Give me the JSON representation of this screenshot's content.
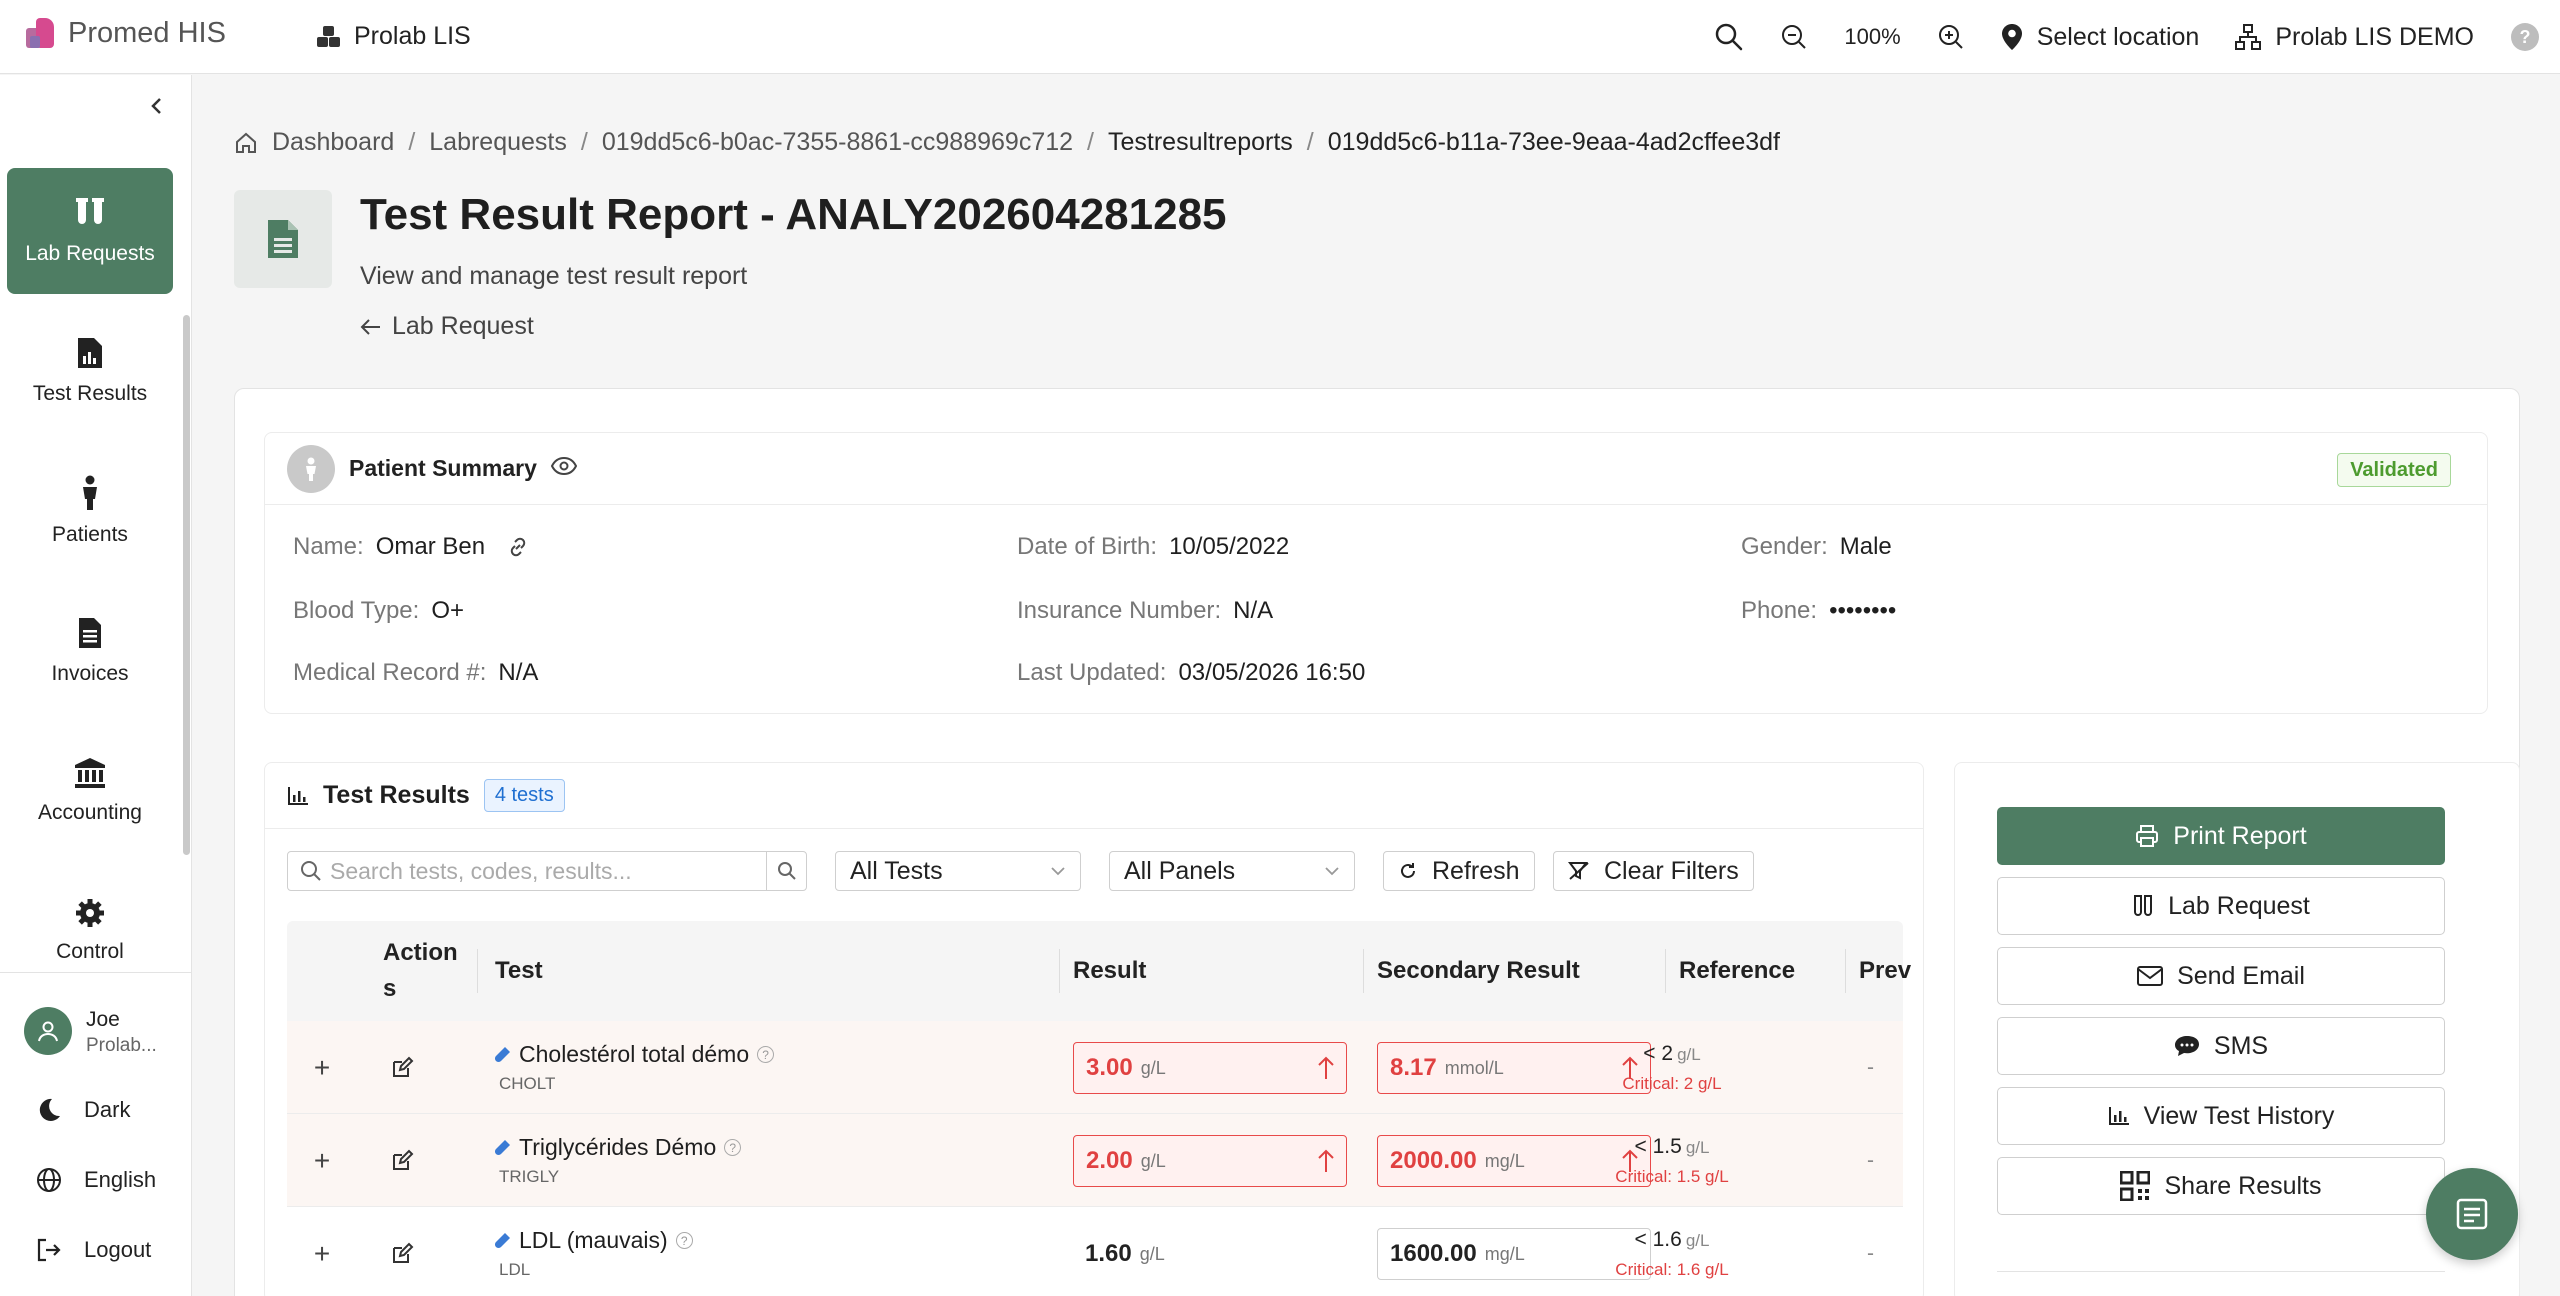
{
  "brand": {
    "name": "Promed HIS"
  },
  "app_switch": {
    "label": "Prolab LIS"
  },
  "topbar": {
    "zoom": "100%",
    "location": "Select location",
    "org": "Prolab LIS DEMO"
  },
  "sidebar": {
    "items": [
      {
        "label": "Lab Requests",
        "icon": "test-tubes-icon",
        "active": true
      },
      {
        "label": "Test Results",
        "icon": "report-chart-icon"
      },
      {
        "label": "Patients",
        "icon": "person-icon"
      },
      {
        "label": "Invoices",
        "icon": "invoice-icon"
      },
      {
        "label": "Accounting",
        "icon": "bank-icon"
      },
      {
        "label": "Control",
        "icon": "gear-icon"
      }
    ],
    "user": {
      "name": "Joe",
      "org": "Prolab..."
    },
    "dark_label": "Dark",
    "lang_label": "English",
    "logout_label": "Logout"
  },
  "breadcrumb": [
    "Dashboard",
    "Labrequests",
    "019dd5c6-b0ac-7355-8861-cc988969c712",
    "Testresultreports",
    "019dd5c6-b11a-73ee-9eaa-4ad2cffee3df"
  ],
  "page": {
    "title": "Test Result Report - ANALY202604281285",
    "subtitle": "View and manage test result report",
    "back_label": "Lab Request"
  },
  "patient": {
    "header": "Patient Summary",
    "status": "Validated",
    "fields": {
      "name": {
        "label": "Name",
        "value": "Omar Ben"
      },
      "dob": {
        "label": "Date of Birth",
        "value": "10/05/2022"
      },
      "gender": {
        "label": "Gender",
        "value": "Male"
      },
      "blood": {
        "label": "Blood Type",
        "value": "O+"
      },
      "insurance": {
        "label": "Insurance Number",
        "value": "N/A"
      },
      "phone": {
        "label": "Phone",
        "value": "••••••••"
      },
      "mrn": {
        "label": "Medical Record #",
        "value": "N/A"
      },
      "updated": {
        "label": "Last Updated",
        "value": "03/05/2026 16:50"
      }
    }
  },
  "tests": {
    "header": "Test Results",
    "count": "4 tests",
    "search_placeholder": "Search tests, codes, results...",
    "filter_tests": "All Tests",
    "filter_panels": "All Panels",
    "refresh_label": "Refresh",
    "clear_label": "Clear Filters",
    "columns": {
      "actions": "Action s",
      "test": "Test",
      "result": "Result",
      "secondary": "Secondary Result",
      "reference": "Reference",
      "prev": "Prev"
    },
    "rows": [
      {
        "name": "Cholestérol total démo",
        "code": "CHOLT",
        "result": "3.00",
        "result_unit": "g/L",
        "result_flag": "high",
        "secondary": "8.17",
        "secondary_unit": "mmol/L",
        "secondary_flag": "high",
        "ref": "< 2",
        "ref_unit": "g/L",
        "critical": "Critical: 2 g/L",
        "prev": "-"
      },
      {
        "name": "Triglycérides Démo",
        "code": "TRIGLY",
        "result": "2.00",
        "result_unit": "g/L",
        "result_flag": "high",
        "secondary": "2000.00",
        "secondary_unit": "mg/L",
        "secondary_flag": "high",
        "ref": "< 1.5",
        "ref_unit": "g/L",
        "critical": "Critical: 1.5 g/L",
        "prev": "-"
      },
      {
        "name": "LDL (mauvais)",
        "code": "LDL",
        "result": "1.60",
        "result_unit": "g/L",
        "result_flag": "plain",
        "secondary": "1600.00",
        "secondary_unit": "mg/L",
        "secondary_flag": "norm",
        "ref": "< 1.6",
        "ref_unit": "g/L",
        "critical": "Critical: 1.6 g/L",
        "prev": "-"
      }
    ]
  },
  "actions": {
    "print": "Print Report",
    "lab_request": "Lab Request",
    "email": "Send Email",
    "sms": "SMS",
    "history": "View Test History",
    "share": "Share Results"
  },
  "colors": {
    "accent": "#4e7d63",
    "danger": "#e04141",
    "badge": "#1f6fd1"
  }
}
